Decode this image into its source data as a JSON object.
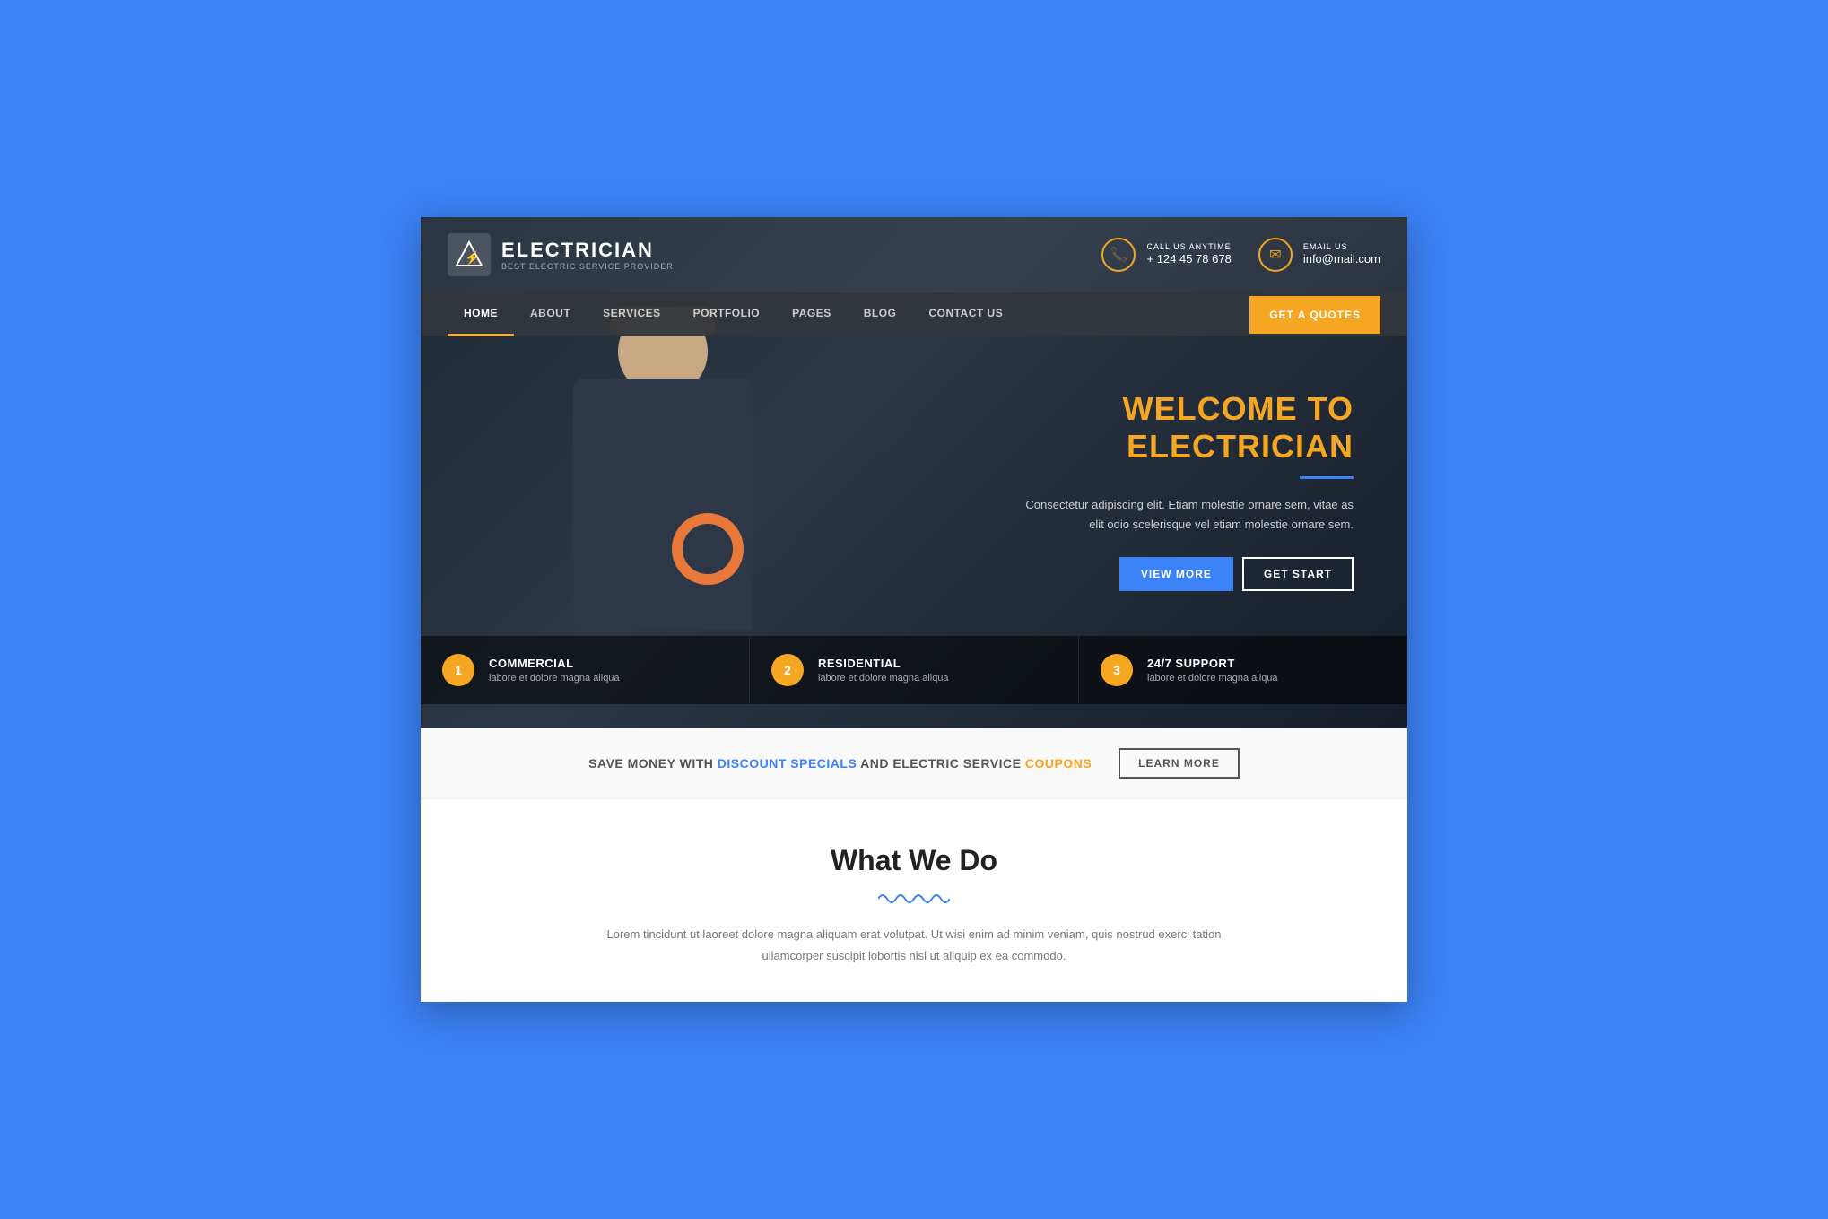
{
  "site": {
    "logo": {
      "icon": "⚡",
      "name": "ELECTRICIAN",
      "tagline": "BEST ELECTRIC SERVICE PROVIDER"
    },
    "contact1": {
      "label": "CALL US ANYTIME",
      "value": "+ 124 45 78 678",
      "icon": "📞"
    },
    "contact2": {
      "label": "EMAIL US",
      "value": "info@mail.com",
      "icon": "✉"
    }
  },
  "nav": {
    "items": [
      {
        "label": "HOME",
        "active": true
      },
      {
        "label": "ABOUT",
        "active": false
      },
      {
        "label": "SERVICES",
        "active": false
      },
      {
        "label": "PORTFOLIO",
        "active": false
      },
      {
        "label": "PAGES",
        "active": false
      },
      {
        "label": "BLOG",
        "active": false
      },
      {
        "label": "CONTACT US",
        "active": false
      }
    ],
    "cta": "GET A QUOTES"
  },
  "hero": {
    "heading_normal": "WELCOME TO",
    "heading_highlight": "ELECTRICIAN",
    "body": "Consectetur adipiscing elit. Etiam molestie ornare sem, vitae as elit odio scelerisque vel etiam molestie ornare sem.",
    "btn1": "VIEW MORE",
    "btn2": "GET START"
  },
  "features": [
    {
      "num": "1",
      "title": "COMMERCIAL",
      "desc": "labore et dolore magna aliqua"
    },
    {
      "num": "2",
      "title": "RESIDENTIAL",
      "desc": "labore et dolore magna aliqua"
    },
    {
      "num": "3",
      "title": "24/7 SUPPORT",
      "desc": "labore et dolore magna aliqua"
    }
  ],
  "banner": {
    "text_before": "SAVE MONEY WITH",
    "highlight1": "DISCOUNT SPECIALS",
    "text_mid": "AND ELECTRIC SERVICE",
    "highlight2": "COUPONS",
    "btn": "LEARN MORE"
  },
  "whatwedo": {
    "heading": "What We Do",
    "body": "Lorem tincidunt ut laoreet dolore magna aliquam erat volutpat. Ut wisi enim ad minim veniam, quis nostrud exerci tation ullamcorper suscipit lobortis nisl ut aliquip ex ea commodo."
  }
}
